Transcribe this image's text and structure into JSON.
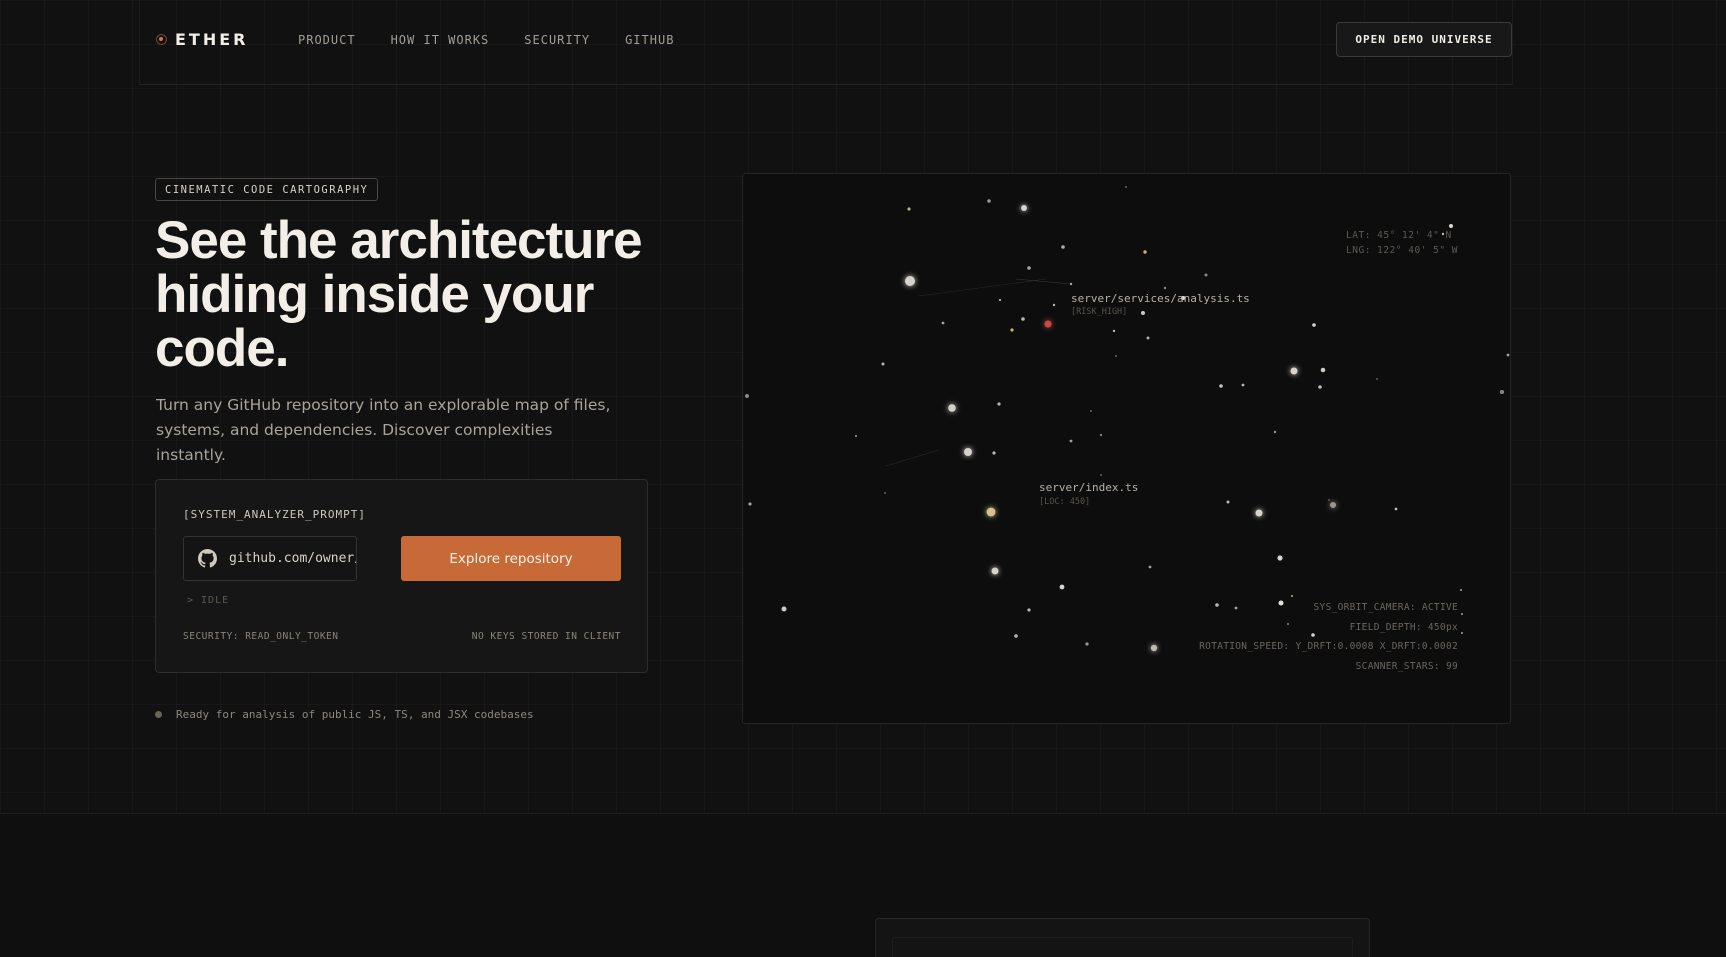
{
  "brand": {
    "name": "ETHER"
  },
  "nav": {
    "links": [
      "PRODUCT",
      "HOW IT WORKS",
      "SECURITY",
      "GITHUB"
    ],
    "cta": "OPEN DEMO UNIVERSE"
  },
  "hero": {
    "badge": "CINEMATIC CODE CARTOGRAPHY",
    "headline_line1": "See the architecture",
    "headline_line2": "hiding inside your",
    "headline_line3": "code.",
    "subtitle_line1": "Turn any GitHub repository into an explorable map of files,",
    "subtitle_line2": "systems, and dependencies. Discover complexities instantly."
  },
  "analyzer": {
    "title": "[SYSTEM_ANALYZER_PROMPT]",
    "input_placeholder": "github.com/owner/repo",
    "button": "Explore repository",
    "status": "> IDLE",
    "security_left": "SECURITY: READ_ONLY_TOKEN",
    "security_right": "NO KEYS STORED IN CLIENT"
  },
  "ready_text": "Ready for analysis of public JS, TS, and JSX codebases",
  "map": {
    "lat": "LAT: 45° 12' 4\" N",
    "lng": "LNG: 122° 40' 5\" W",
    "node_a": {
      "label": "server/services/analysis.ts",
      "tag": "[RISK_HIGH]"
    },
    "node_b": {
      "label": "server/index.ts",
      "tag": "[LOC: 450]"
    },
    "telemetry": {
      "camera": "SYS_ORBIT_CAMERA: ACTIVE",
      "depth": "FIELD_DEPTH: 450px",
      "rotation": "ROTATION_SPEED: Y_DRFT:0.0008 X_DRFT:0.0002",
      "stars": "SCANNER_STARS: 99"
    }
  },
  "colors": {
    "accent": "#c76a38",
    "risk": "#c94a45",
    "node_warm": "#d8c48a",
    "background": "#111111"
  }
}
